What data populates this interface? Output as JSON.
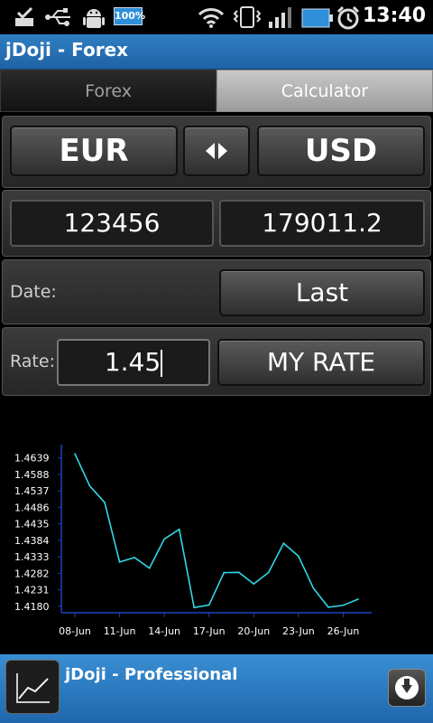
{
  "status_bar": {
    "battery_label": "100%",
    "time": "13:40",
    "icons": [
      "notification-check-icon",
      "usb-icon",
      "android-debug-icon",
      "battery-full-icon",
      "wifi-icon",
      "vibrate-icon",
      "signal-icon",
      "battery-icon",
      "alarm-icon"
    ]
  },
  "app": {
    "title": "jDoji - Forex"
  },
  "tabs": [
    {
      "label": "Forex",
      "selected": false
    },
    {
      "label": "Calculator",
      "selected": true
    }
  ],
  "currency": {
    "from": "EUR",
    "to": "USD",
    "swap_icon": "swap-arrows-icon"
  },
  "amounts": {
    "from_value": "123456",
    "to_value": "179011.2"
  },
  "date": {
    "label": "Date:",
    "value": "Last"
  },
  "rate": {
    "label": "Rate:",
    "value": "1.45",
    "button": "MY RATE"
  },
  "chart_data": {
    "type": "line",
    "title": "",
    "xlabel": "",
    "ylabel": "",
    "y_ticks": [
      "1.4639",
      "1.4588",
      "1.4537",
      "1.4486",
      "1.4435",
      "1.4384",
      "1.4333",
      "1.4282",
      "1.4231",
      "1.4180"
    ],
    "x_ticks": [
      "08-Jun",
      "11-Jun",
      "14-Jun",
      "17-Jun",
      "20-Jun",
      "23-Jun",
      "26-Jun"
    ],
    "ylim": [
      1.416,
      1.468
    ],
    "x": [
      0,
      1,
      2,
      3,
      4,
      5,
      6,
      7,
      8,
      9,
      10,
      11,
      12,
      13,
      14,
      15,
      16,
      17,
      18,
      19
    ],
    "values": [
      1.4652,
      1.4552,
      1.4501,
      1.4317,
      1.4331,
      1.4298,
      1.4388,
      1.4418,
      1.4176,
      1.4184,
      1.4284,
      1.4285,
      1.4249,
      1.4285,
      1.4375,
      1.4335,
      1.4236,
      1.4177,
      1.4183,
      1.4202
    ],
    "series_color": "#33d6e6",
    "axis_color": "#1f3fc4",
    "grid": false
  },
  "ad": {
    "title": "jDoji - Professional",
    "icon": "line-chart-icon",
    "action_icon": "download-icon"
  }
}
